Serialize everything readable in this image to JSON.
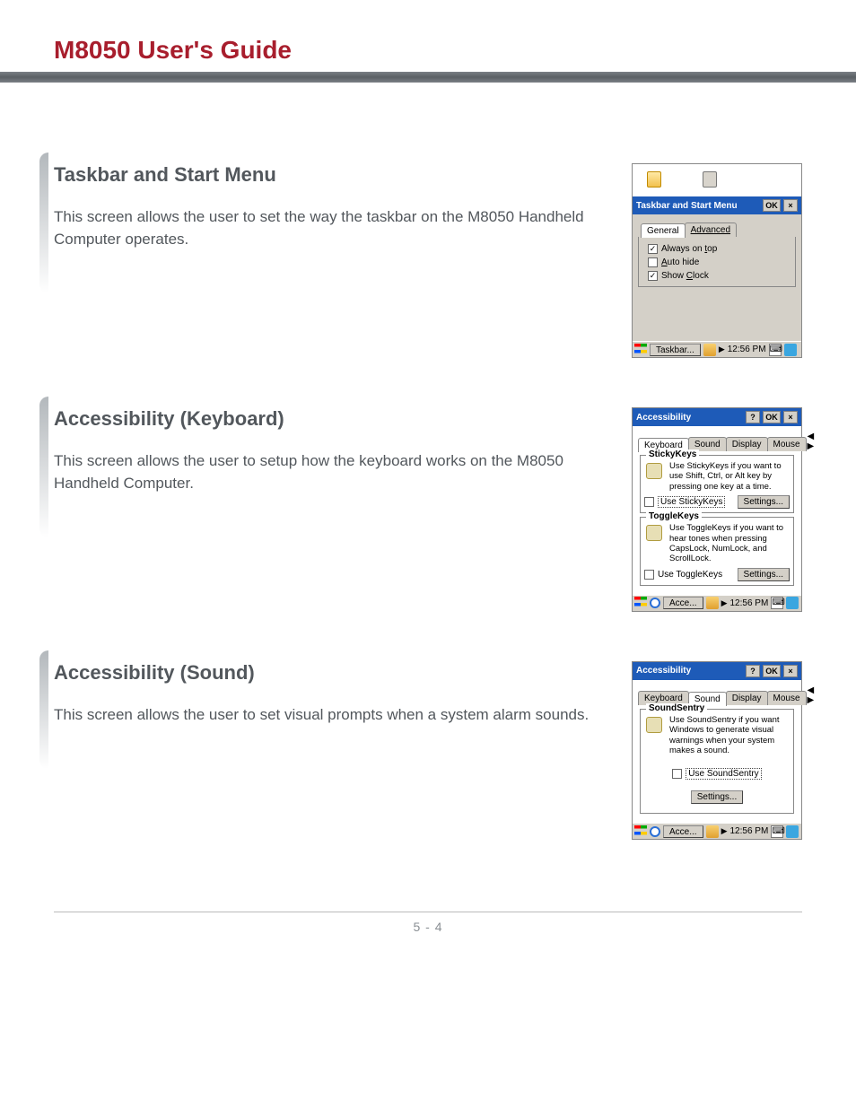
{
  "page_title": "M8050 User's Guide",
  "footer": "5 - 4",
  "sections": [
    {
      "heading": "Taskbar and Start Menu",
      "desc": "This screen allows the user to set the way the taskbar on the M8050 Handheld Computer operates."
    },
    {
      "heading": "Accessibility (Keyboard)",
      "desc": "This screen allows the user to setup how the keyboard works on the M8050 Handheld Computer."
    },
    {
      "heading": "Accessibility (Sound)",
      "desc": "This screen allows the user to set visual prompts when a system alarm sounds."
    }
  ],
  "shot_taskbar": {
    "title": "Taskbar and Start Menu",
    "ok": "OK",
    "tabs": {
      "general": "General",
      "advanced": "Advanced"
    },
    "opts": {
      "always_pre": "Always on ",
      "always_u": "t",
      "always_post": "op",
      "auto_u": "A",
      "auto_post": "uto hide",
      "show_pre": "Show ",
      "show_u": "C",
      "show_post": "lock"
    },
    "status_app": "Taskbar...",
    "status_time": "12:56 PM"
  },
  "shot_kbd": {
    "title": "Accessibility",
    "ok": "OK",
    "tabs": {
      "keyboard": "Keyboard",
      "sound": "Sound",
      "display": "Display",
      "mouse": "Mouse"
    },
    "sticky": {
      "legend": "StickyKeys",
      "desc": "Use StickyKeys if you want to use Shift, Ctrl, or Alt key by pressing one key at a time.",
      "use": "Use StickyKeys",
      "settings": "Settings..."
    },
    "toggle": {
      "legend": "ToggleKeys",
      "desc": "Use ToggleKeys if you want to hear tones when pressing CapsLock, NumLock, and ScrollLock.",
      "use": "Use ToggleKeys",
      "settings": "Settings..."
    },
    "status_app": "Acce...",
    "status_time": "12:56 PM"
  },
  "shot_snd": {
    "title": "Accessibility",
    "ok": "OK",
    "tabs": {
      "keyboard": "Keyboard",
      "sound": "Sound",
      "display": "Display",
      "mouse": "Mouse"
    },
    "sentry": {
      "legend": "SoundSentry",
      "desc": "Use SoundSentry if you want Windows to generate visual warnings when your system makes a sound.",
      "use": "Use SoundSentry",
      "settings": "Settings..."
    },
    "status_app": "Acce...",
    "status_time": "12:56 PM"
  }
}
